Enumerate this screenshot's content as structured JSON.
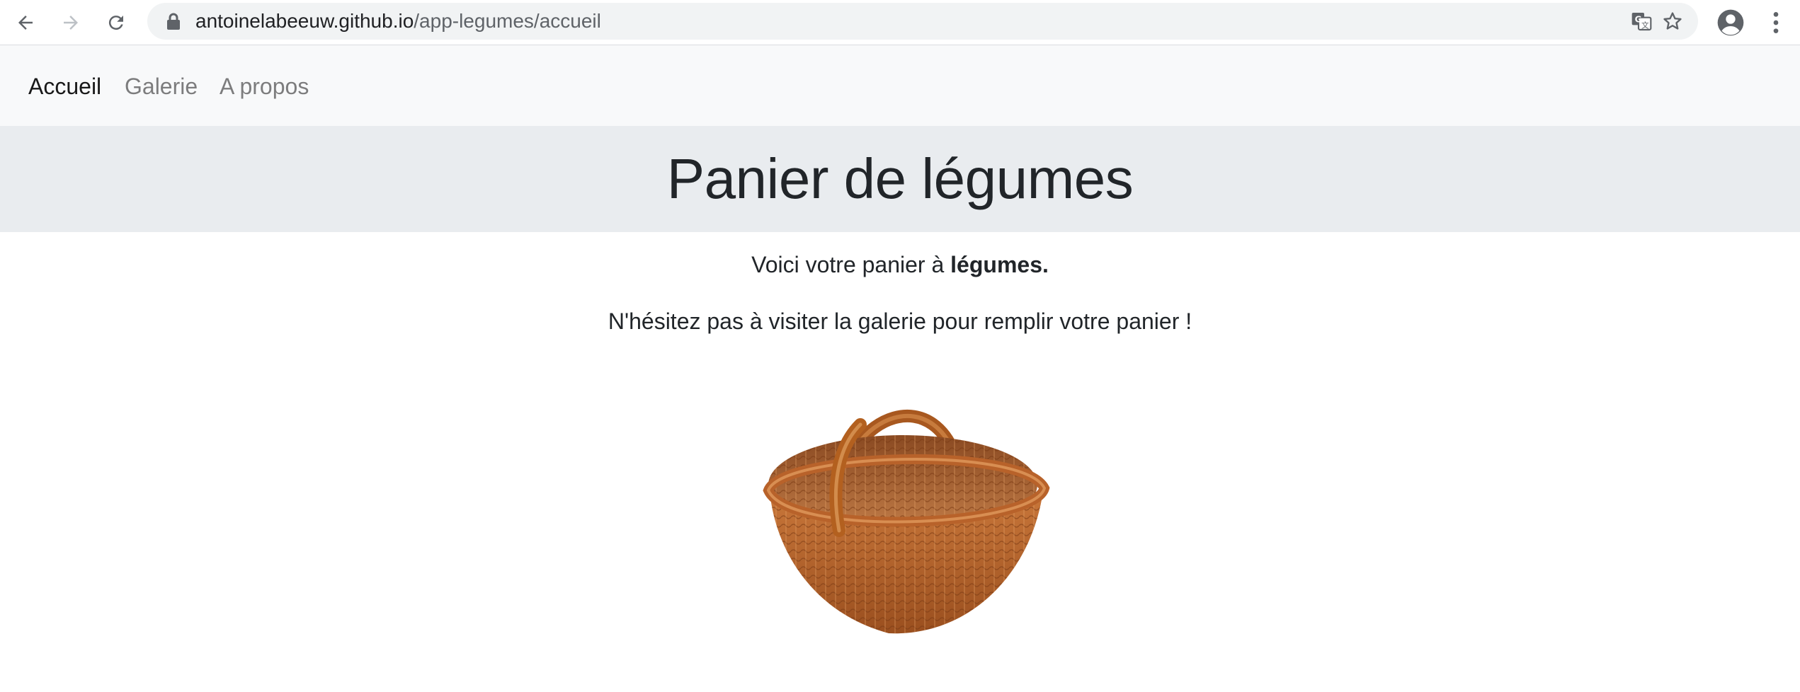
{
  "browser": {
    "url_host": "antoinelabeeuw.github.io",
    "url_path": "/app-legumes/accueil",
    "icons": [
      "back-arrow-icon",
      "forward-arrow-icon",
      "reload-icon",
      "lock-icon",
      "translate-icon",
      "star-icon",
      "profile-icon",
      "kebab-menu-icon"
    ]
  },
  "navbar": {
    "items": [
      {
        "label": "Accueil",
        "active": true
      },
      {
        "label": "Galerie",
        "active": false
      },
      {
        "label": "A propos",
        "active": false
      }
    ]
  },
  "hero": {
    "title": "Panier de légumes"
  },
  "content": {
    "line1_prefix": "Voici votre panier à ",
    "line1_bold": "légumes.",
    "line2": "N'hésitez pas à visiter la galerie pour remplir votre panier !",
    "image": "wicker-basket"
  },
  "colors": {
    "navbar_bg": "#f8f9fa",
    "hero_bg": "#e9ecef",
    "basket": "#b5652a"
  }
}
